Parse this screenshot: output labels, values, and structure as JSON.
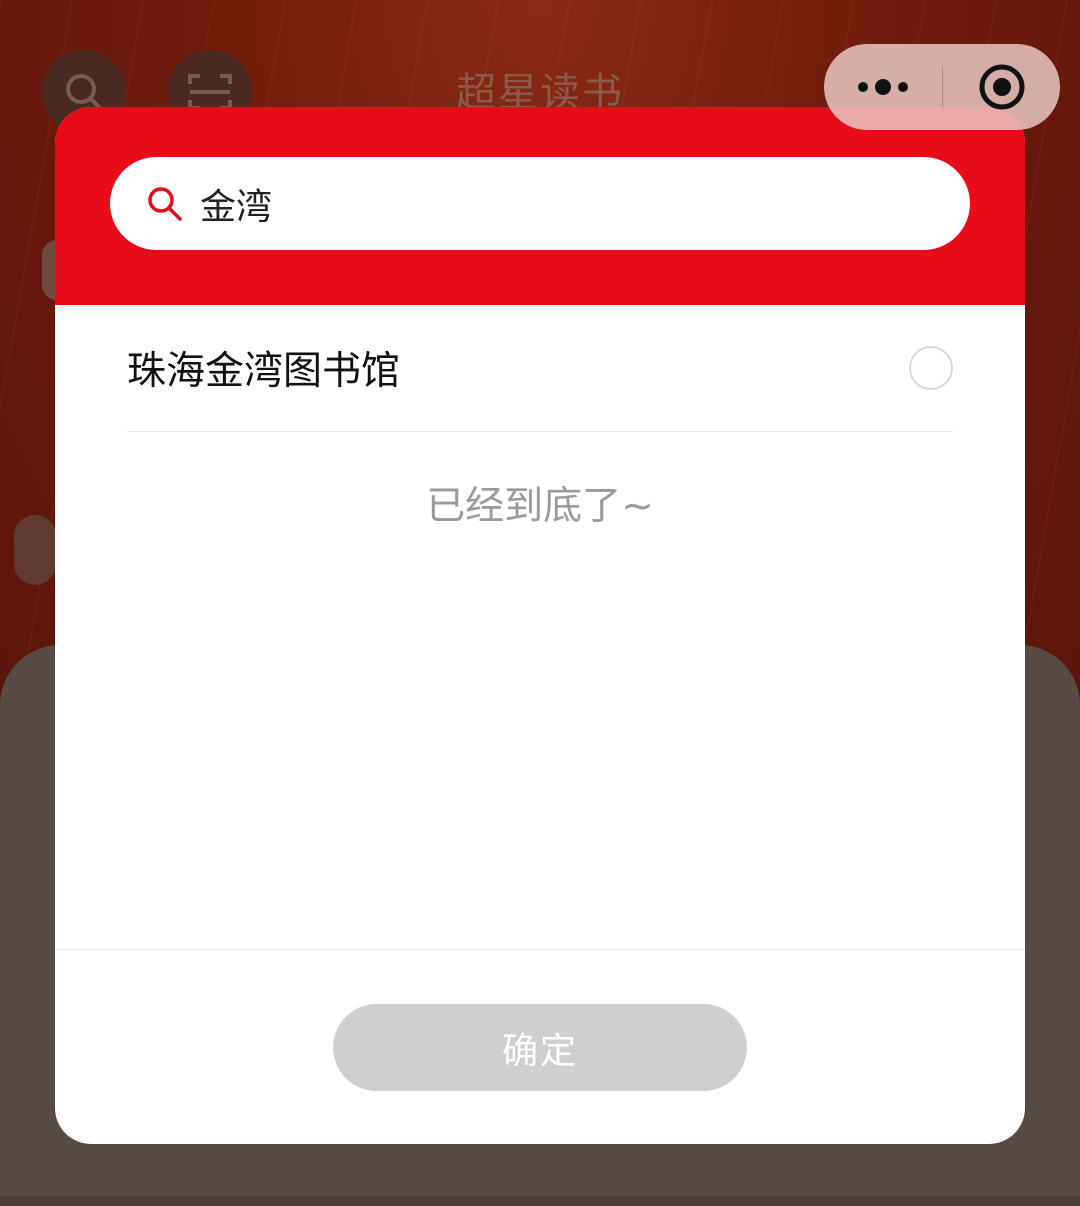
{
  "background_app": {
    "title": "超星读书",
    "left_icons": [
      "search-icon",
      "scan-icon"
    ]
  },
  "capsule": {
    "more_icon": "more-dots-icon",
    "close_icon": "target-circle-icon"
  },
  "modal": {
    "search": {
      "icon": "search-icon",
      "value": "金湾",
      "accent_color": "#e80b18"
    },
    "results": [
      {
        "label": "珠海金湾图书馆",
        "selected": false
      }
    ],
    "end_text": "已经到底了~",
    "confirm_label": "确定",
    "confirm_enabled": false
  },
  "colors": {
    "header_red": "#e80b18",
    "button_disabled": "#cfcfcf",
    "muted_text": "#9a9a9a"
  }
}
